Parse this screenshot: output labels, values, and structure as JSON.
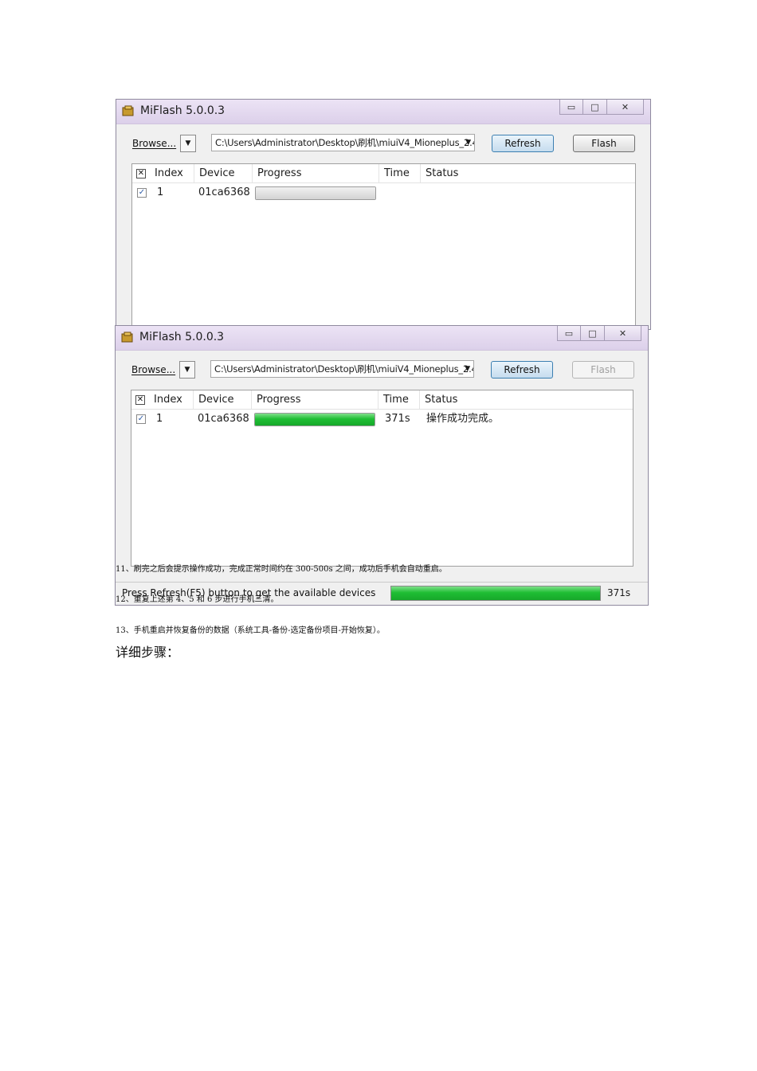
{
  "windows": [
    {
      "title": "MiFlash 5.0.0.3",
      "browse_label": "Browse...",
      "path": "C:\\Users\\Administrator\\Desktop\\刷机\\miuiV4_Mioneplus_2.4",
      "refresh_label": "Refresh",
      "flash_label": "Flash",
      "columns": [
        "Index",
        "Device",
        "Progress",
        "Time",
        "Status"
      ],
      "rows": [
        {
          "index": "1",
          "device": "01ca6368",
          "progress": 0,
          "time": "",
          "status": ""
        }
      ]
    },
    {
      "title": "MiFlash 5.0.0.3",
      "browse_label": "Browse...",
      "path": "C:\\Users\\Administrator\\Desktop\\刷机\\miuiV4_Mioneplus_2.4",
      "refresh_label": "Refresh",
      "flash_label": "Flash",
      "columns": [
        "Index",
        "Device",
        "Progress",
        "Time",
        "Status"
      ],
      "rows": [
        {
          "index": "1",
          "device": "01ca6368",
          "progress": 100,
          "time": "371s",
          "status": "操作成功完成。"
        }
      ],
      "status_bar": {
        "text": "Press Refresh(F5) button to get the available devices",
        "progress": 100,
        "time": "371s"
      }
    }
  ],
  "doc": {
    "line11": "11、刷完之后会提示操作成功，完成正常时间约在 300-500s 之间，成功后手机会自动重启。",
    "line12": "12、重复上述第 4、5 和 6 步进行手机三清。",
    "line13": "13、手机重启并恢复备份的数据（系统工具-备份-选定备份项目-开始恢复）。",
    "heading": "详细步骤："
  },
  "colors": {
    "progress_green": "#1fbe34",
    "title_bar": "#e4daf0"
  }
}
